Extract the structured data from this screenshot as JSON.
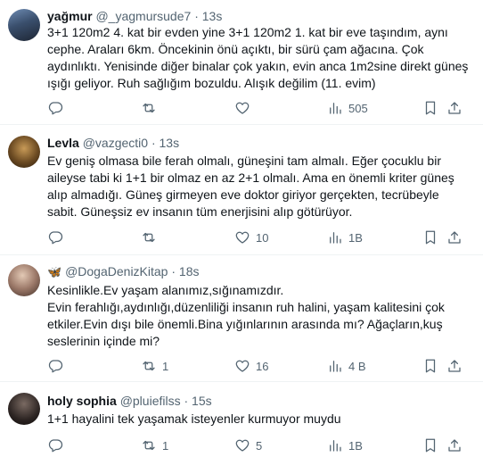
{
  "tweets": [
    {
      "name": "yağmur",
      "handle": "@_yagmursude7",
      "sep": "·",
      "time": "13s",
      "lines": [
        "3+1 120m2 4. kat bir evden yine 3+1 120m2 1. kat bir eve taşındım, aynı",
        "cephe. Araları 6km. Öncekinin önü açıktı, bir sürü çam ağacına. Çok",
        "aydınlıktı. Yenisinde diğer binalar çok yakın, evin anca 1m2sine direkt güneş",
        "ışığı geliyor. Ruh sağlığım bozuldu. Alışık değilim (11. evim)"
      ],
      "counts": {
        "reply": "",
        "retweet": "",
        "like": "",
        "views": "505"
      }
    },
    {
      "name": "Levla",
      "handle": "@vazgecti0",
      "sep": "·",
      "time": "13s",
      "lines": [
        "Ev geniş olmasa bile ferah olmalı, güneşini tam almalı. Eğer çocuklu bir",
        "aileyse tabi ki 1+1 bir olmaz en az 2+1 olmalı. Ama en önemli kriter güneş",
        "alıp almadığı. Güneş girmeyen eve doktor giriyor gerçekten, tecrübeyle",
        "sabit. Güneşsiz ev insanın tüm enerjisini alıp götürüyor."
      ],
      "counts": {
        "reply": "",
        "retweet": "",
        "like": "10",
        "views": "1B"
      }
    },
    {
      "name": "",
      "badge": "🦋",
      "handle": "@DogaDenizKitap",
      "sep": "·",
      "time": "18s",
      "lines": [
        "Kesinlikle.Ev yaşam alanımız,sığınamızdır.",
        "Evin ferahlığı,aydınlığı,düzenliliği insanın ruh halini, yaşam kalitesini çok",
        "etkiler.Evin dışı bile önemli.Bina yığınlarının arasında mı? Ağaçların,kuş",
        "seslerinin içinde mi?"
      ],
      "counts": {
        "reply": "",
        "retweet": "1",
        "like": "16",
        "views": "4 B"
      }
    },
    {
      "name": "holy sophia",
      "handle": "@pluiefilss",
      "sep": "·",
      "time": "15s",
      "lines": [
        "1+1 hayalini tek yaşamak isteyenler kurmuyor muydu"
      ],
      "counts": {
        "reply": "",
        "retweet": "1",
        "like": "5",
        "views": "1B"
      }
    }
  ],
  "icons": {
    "reply": "reply-icon",
    "retweet": "retweet-icon",
    "like": "heart-icon",
    "views": "views-icon",
    "bookmark": "bookmark-icon",
    "share": "share-icon"
  }
}
